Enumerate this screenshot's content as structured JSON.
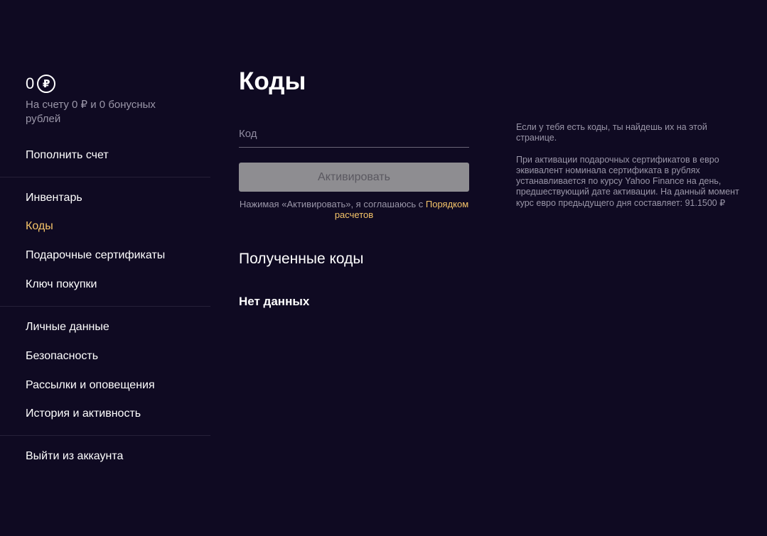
{
  "sidebar": {
    "balance_amount": "0",
    "currency_symbol": "₽",
    "balance_description": "На счету 0 ₽ и 0 бонусных рублей",
    "topup_label": "Пополнить счет",
    "groups": [
      [
        {
          "label": "Инвентарь",
          "active": false
        },
        {
          "label": "Коды",
          "active": true
        },
        {
          "label": "Подарочные сертификаты",
          "active": false
        },
        {
          "label": "Ключ покупки",
          "active": false
        }
      ],
      [
        {
          "label": "Личные данные",
          "active": false
        },
        {
          "label": "Безопасность",
          "active": false
        },
        {
          "label": "Рассылки и оповещения",
          "active": false
        },
        {
          "label": "История и активность",
          "active": false
        }
      ]
    ],
    "logout_label": "Выйти из аккаунта"
  },
  "main": {
    "title": "Коды",
    "code_input": {
      "placeholder": "Код",
      "value": ""
    },
    "activate_label": "Активировать",
    "consent_text": "Нажимая «Активировать», я соглашаюсь с",
    "consent_link": "Порядком расчетов",
    "received_title": "Полученные коды",
    "empty_text": "Нет данных"
  },
  "info": {
    "paragraph1": "Если у тебя есть коды, ты найдешь их на этой странице.",
    "paragraph2": "При активации подарочных сертификатов в евро эквивалент номинала сертификата в рублях устанавливается по курсу Yahoo Finance на день, предшествующий дате активации. На данный момент курс евро предыдущего дня составляет: 91.1500 ₽"
  },
  "colors": {
    "background": "#0f0a22",
    "accent": "#f5c469",
    "muted_text": "#9a96a8",
    "button_disabled": "#8e8d91"
  }
}
